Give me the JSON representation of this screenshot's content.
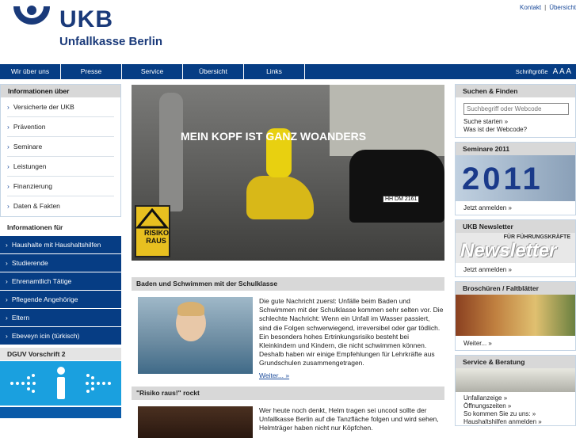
{
  "header": {
    "logo_text": "UKB",
    "logo_subtitle": "Unfallkasse Berlin",
    "toplinks": [
      "Kontakt",
      "Übersicht"
    ],
    "toplink_separator": "|"
  },
  "nav": {
    "items": [
      "Wir über uns",
      "Presse",
      "Service",
      "Übersicht",
      "Links"
    ],
    "font_size_label": "Schriftgröße",
    "font_size_options": "A A A"
  },
  "left": {
    "info_title": "Informationen über",
    "info_items": [
      "Versicherte der UKB",
      "Prävention",
      "Seminare",
      "Leistungen",
      "Finanzierung",
      "Daten & Fakten"
    ],
    "for_title": "Informationen für",
    "for_items": [
      "Haushalte mit Haushaltshilfen",
      "Studierende",
      "Ehrenamtlich Tätige",
      "Pflegende Angehörige",
      "Eltern",
      "Ebeveyn icin (türkisch)"
    ],
    "dguv_title": "DGUV Vorschrift 2"
  },
  "center": {
    "hero_tagline": "MEIN KOPF IST    GANZ WOANDERS",
    "hero_sign": "RISIKO RAUS",
    "hero_plate": "HH DM 2161",
    "article1_title": "Baden und Schwimmen mit der Schulklasse",
    "article1_text": "Die gute Nachricht zuerst: Unfälle beim Baden und Schwimmen mit der Schulklasse kommen sehr selten vor. Die schlechte Nachricht: Wenn ein Unfall im Wasser passiert, sind die Folgen schwerwiegend, irreversibel oder gar tödlich. Ein besonders hohes Ertrinkungsrisiko besteht bei Kleinkindern und Kindern, die nicht schwimmen können. Deshalb haben wir einige Empfehlungen für Lehrkräfte aus Grundschulen zusammengetragen.",
    "article1_more": "Weiter... »",
    "article2_title": "\"Risiko raus!\" rockt",
    "article2_text": "Wer heute noch denkt, Helm tragen sei uncool sollte der Unfallkasse Berlin auf die Tanzfläche folgen und wird sehen, Helmträger haben nicht nur Köpfchen."
  },
  "right": {
    "search_title": "Suchen & Finden",
    "search_placeholder": "Suchbegriff oder Webcode",
    "search_start": "Suche starten »",
    "webcode_link": "Was ist der Webcode?",
    "seminar_title": "Seminare 2011",
    "seminar_year": "2011",
    "seminar_link": "Jetzt anmelden »",
    "newsletter_title": "UKB Newsletter",
    "newsletter_small": "FÜR FÜHRUNGSKRÄFTE",
    "newsletter_big": "Newsletter",
    "newsletter_link": "Jetzt anmelden »",
    "brochures_title": "Broschüren / Faltblätter",
    "brochures_link": "Weiter... »",
    "service_title": "Service & Beratung",
    "service_links": [
      "Unfallanzeige »",
      "Öffnungszeiten »",
      "So kommen Sie zu uns: »",
      "Haushaltshilfen anmelden »"
    ]
  },
  "colors": {
    "nav_blue": "#063d84",
    "brand_blue": "#1a3a7a",
    "dguv_cyan": "#1aa0df"
  }
}
